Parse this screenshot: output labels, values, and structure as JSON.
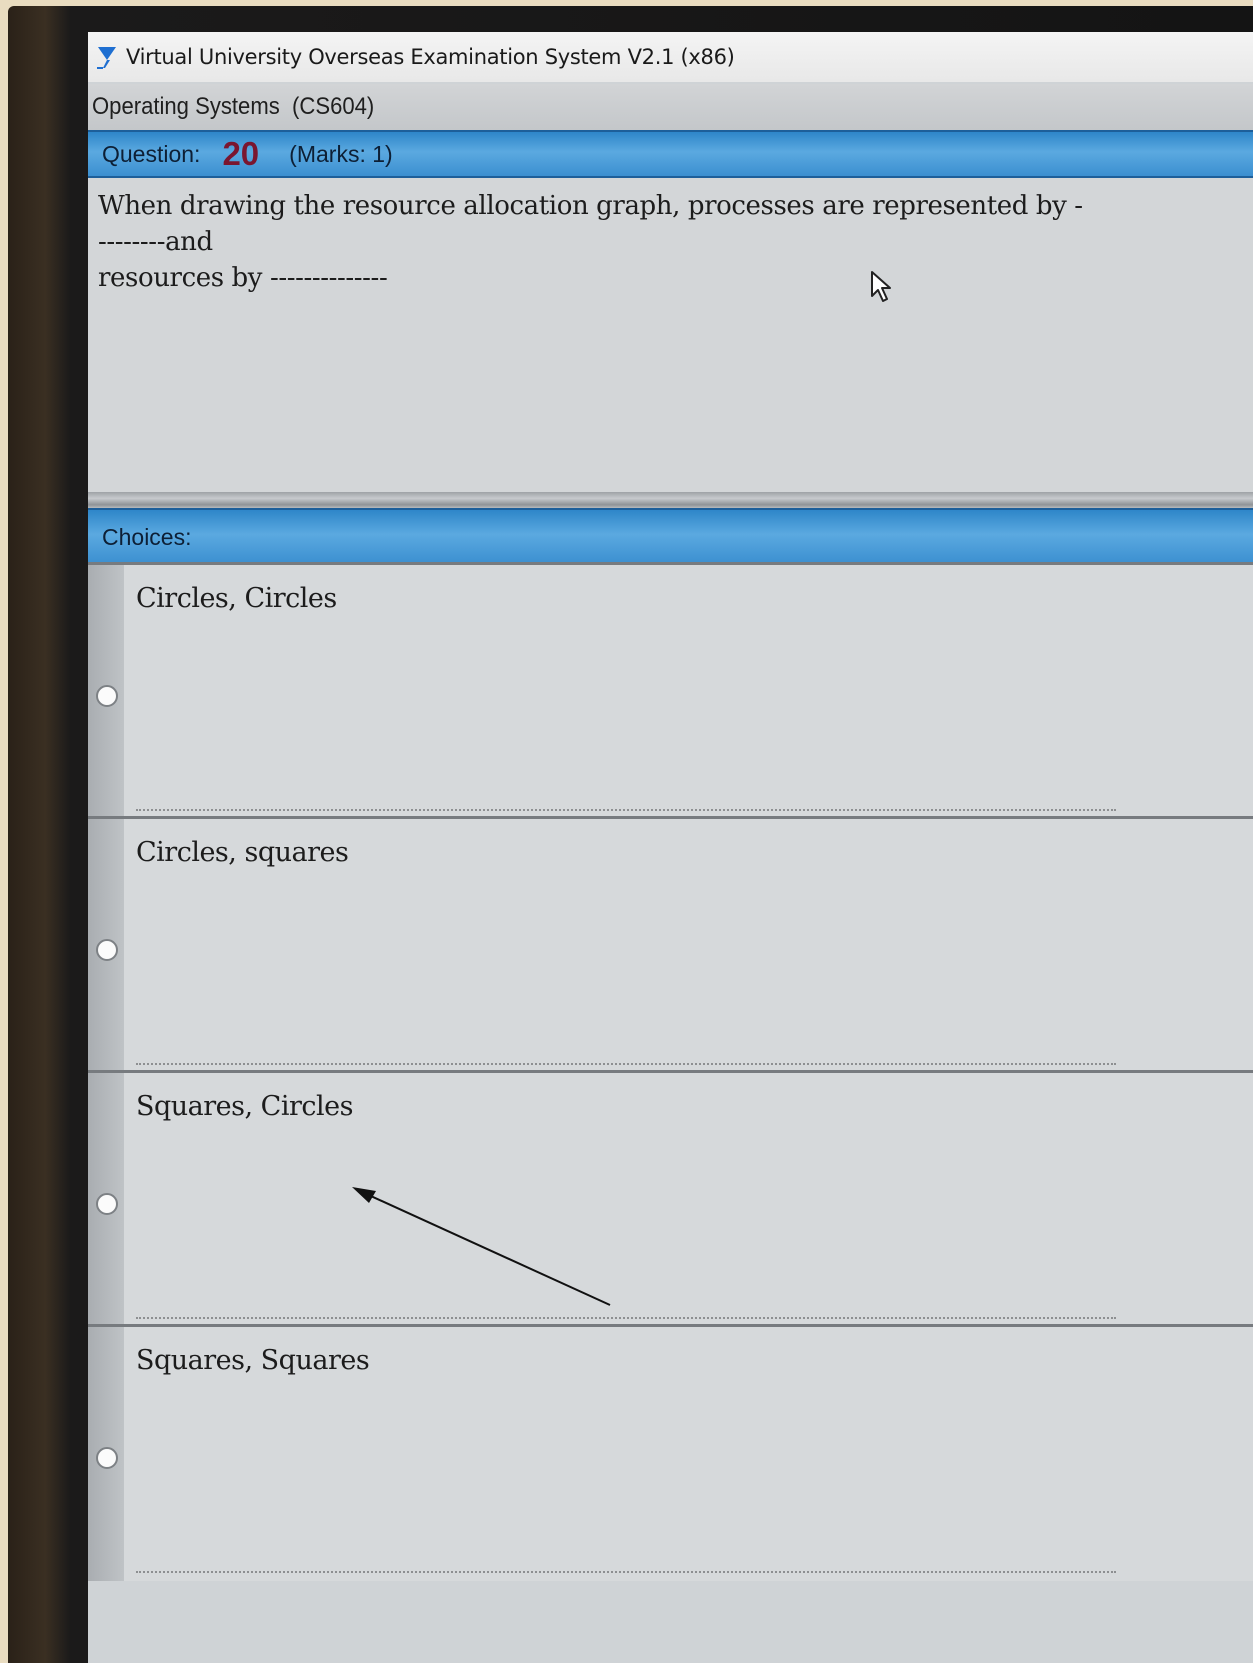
{
  "window": {
    "title": "Virtual University Overseas Examination System  V2.1 (x86)",
    "icon": "vu-logo-icon"
  },
  "course": {
    "name": "Operating Systems",
    "code": "(CS604)"
  },
  "question": {
    "label": "Question:",
    "number": "20",
    "marks": "(Marks: 1)",
    "text_line1": "When drawing the resource allocation graph, processes are represented by ---------and",
    "text_line2": "resources by --------------"
  },
  "choices": {
    "label": "Choices:",
    "options": [
      {
        "text": "Circles, Circles",
        "selected": false
      },
      {
        "text": "Circles, squares",
        "selected": false
      },
      {
        "text": "Squares, Circles",
        "selected": false
      },
      {
        "text": "Squares, Squares",
        "selected": false
      }
    ]
  },
  "colors": {
    "header_blue": "#3b8fd0",
    "question_number": "#7a1630",
    "pane_gray": "#d6d9db"
  }
}
